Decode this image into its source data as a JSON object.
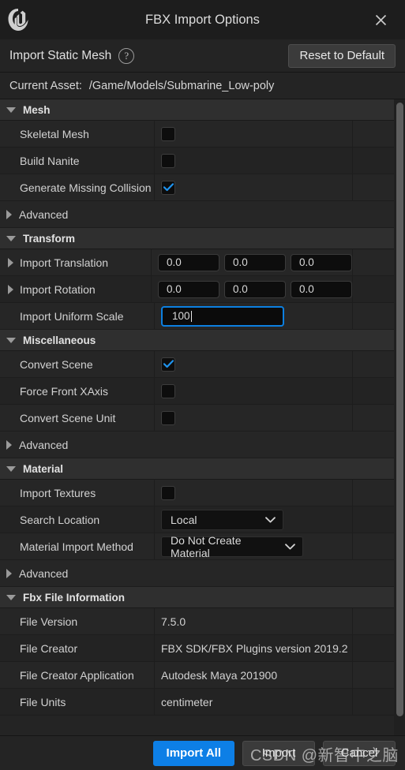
{
  "titlebar": {
    "logo_icon": "unreal-engine-logo",
    "title": "FBX Import Options",
    "close_icon": "close-icon"
  },
  "subheader": {
    "title": "Import Static Mesh",
    "help_icon": "help-circle-icon",
    "reset_label": "Reset to Default"
  },
  "asset": {
    "label": "Current Asset:",
    "path": "/Game/Models/Submarine_Low-poly"
  },
  "sections": [
    {
      "name": "Mesh",
      "expanded": true,
      "rows": [
        {
          "label": "Skeletal Mesh",
          "type": "checkbox",
          "checked": false,
          "expandable": false
        },
        {
          "label": "Build Nanite",
          "type": "checkbox",
          "checked": false,
          "expandable": false
        },
        {
          "label": "Generate Missing Collision",
          "type": "checkbox",
          "checked": true,
          "expandable": false
        }
      ],
      "advanced_label": "Advanced"
    },
    {
      "name": "Transform",
      "expanded": true,
      "rows": [
        {
          "label": "Import Translation",
          "type": "vector3",
          "values": [
            "0.0",
            "0.0",
            "0.0"
          ],
          "expandable": true
        },
        {
          "label": "Import Rotation",
          "type": "vector3",
          "values": [
            "0.0",
            "0.0",
            "0.0"
          ],
          "expandable": true
        },
        {
          "label": "Import Uniform Scale",
          "type": "number-focused",
          "value": "100",
          "expandable": false
        }
      ],
      "advanced_label": null
    },
    {
      "name": "Miscellaneous",
      "expanded": true,
      "rows": [
        {
          "label": "Convert Scene",
          "type": "checkbox",
          "checked": true,
          "expandable": false
        },
        {
          "label": "Force Front XAxis",
          "type": "checkbox",
          "checked": false,
          "expandable": false
        },
        {
          "label": "Convert Scene Unit",
          "type": "checkbox",
          "checked": false,
          "expandable": false
        }
      ],
      "advanced_label": "Advanced"
    },
    {
      "name": "Material",
      "expanded": true,
      "rows": [
        {
          "label": "Import Textures",
          "type": "checkbox",
          "checked": false,
          "expandable": false
        },
        {
          "label": "Search Location",
          "type": "dropdown",
          "value": "Local",
          "variant": "search-loc",
          "expandable": false
        },
        {
          "label": "Material Import Method",
          "type": "dropdown",
          "value": "Do Not Create Material",
          "variant": "mat-method",
          "expandable": false
        }
      ],
      "advanced_label": "Advanced"
    },
    {
      "name": "Fbx File Information",
      "expanded": true,
      "rows": [
        {
          "label": "File Version",
          "type": "text",
          "value": "7.5.0",
          "expandable": false
        },
        {
          "label": "File Creator",
          "type": "text",
          "value": "FBX SDK/FBX Plugins version 2019.2",
          "expandable": false
        },
        {
          "label": "File Creator Application",
          "type": "text",
          "value": "Autodesk Maya 201900",
          "expandable": false
        },
        {
          "label": "File Units",
          "type": "text",
          "value": "centimeter",
          "expandable": false
        }
      ],
      "advanced_label": null
    }
  ],
  "scrollbar": {
    "thumb_name": "scrollbar-thumb"
  },
  "footer": {
    "import_all_label": "Import All",
    "import_label": "Import",
    "cancel_label": "Cancel"
  },
  "watermark": {
    "text": "CSDN @新智中之脑"
  },
  "colors": {
    "accent_blue": "#0d7fe6",
    "focus_border": "#0c7fe0",
    "panel_bg": "#242424",
    "category_bg": "#2f2f2f",
    "text": "#d2d2d2"
  }
}
